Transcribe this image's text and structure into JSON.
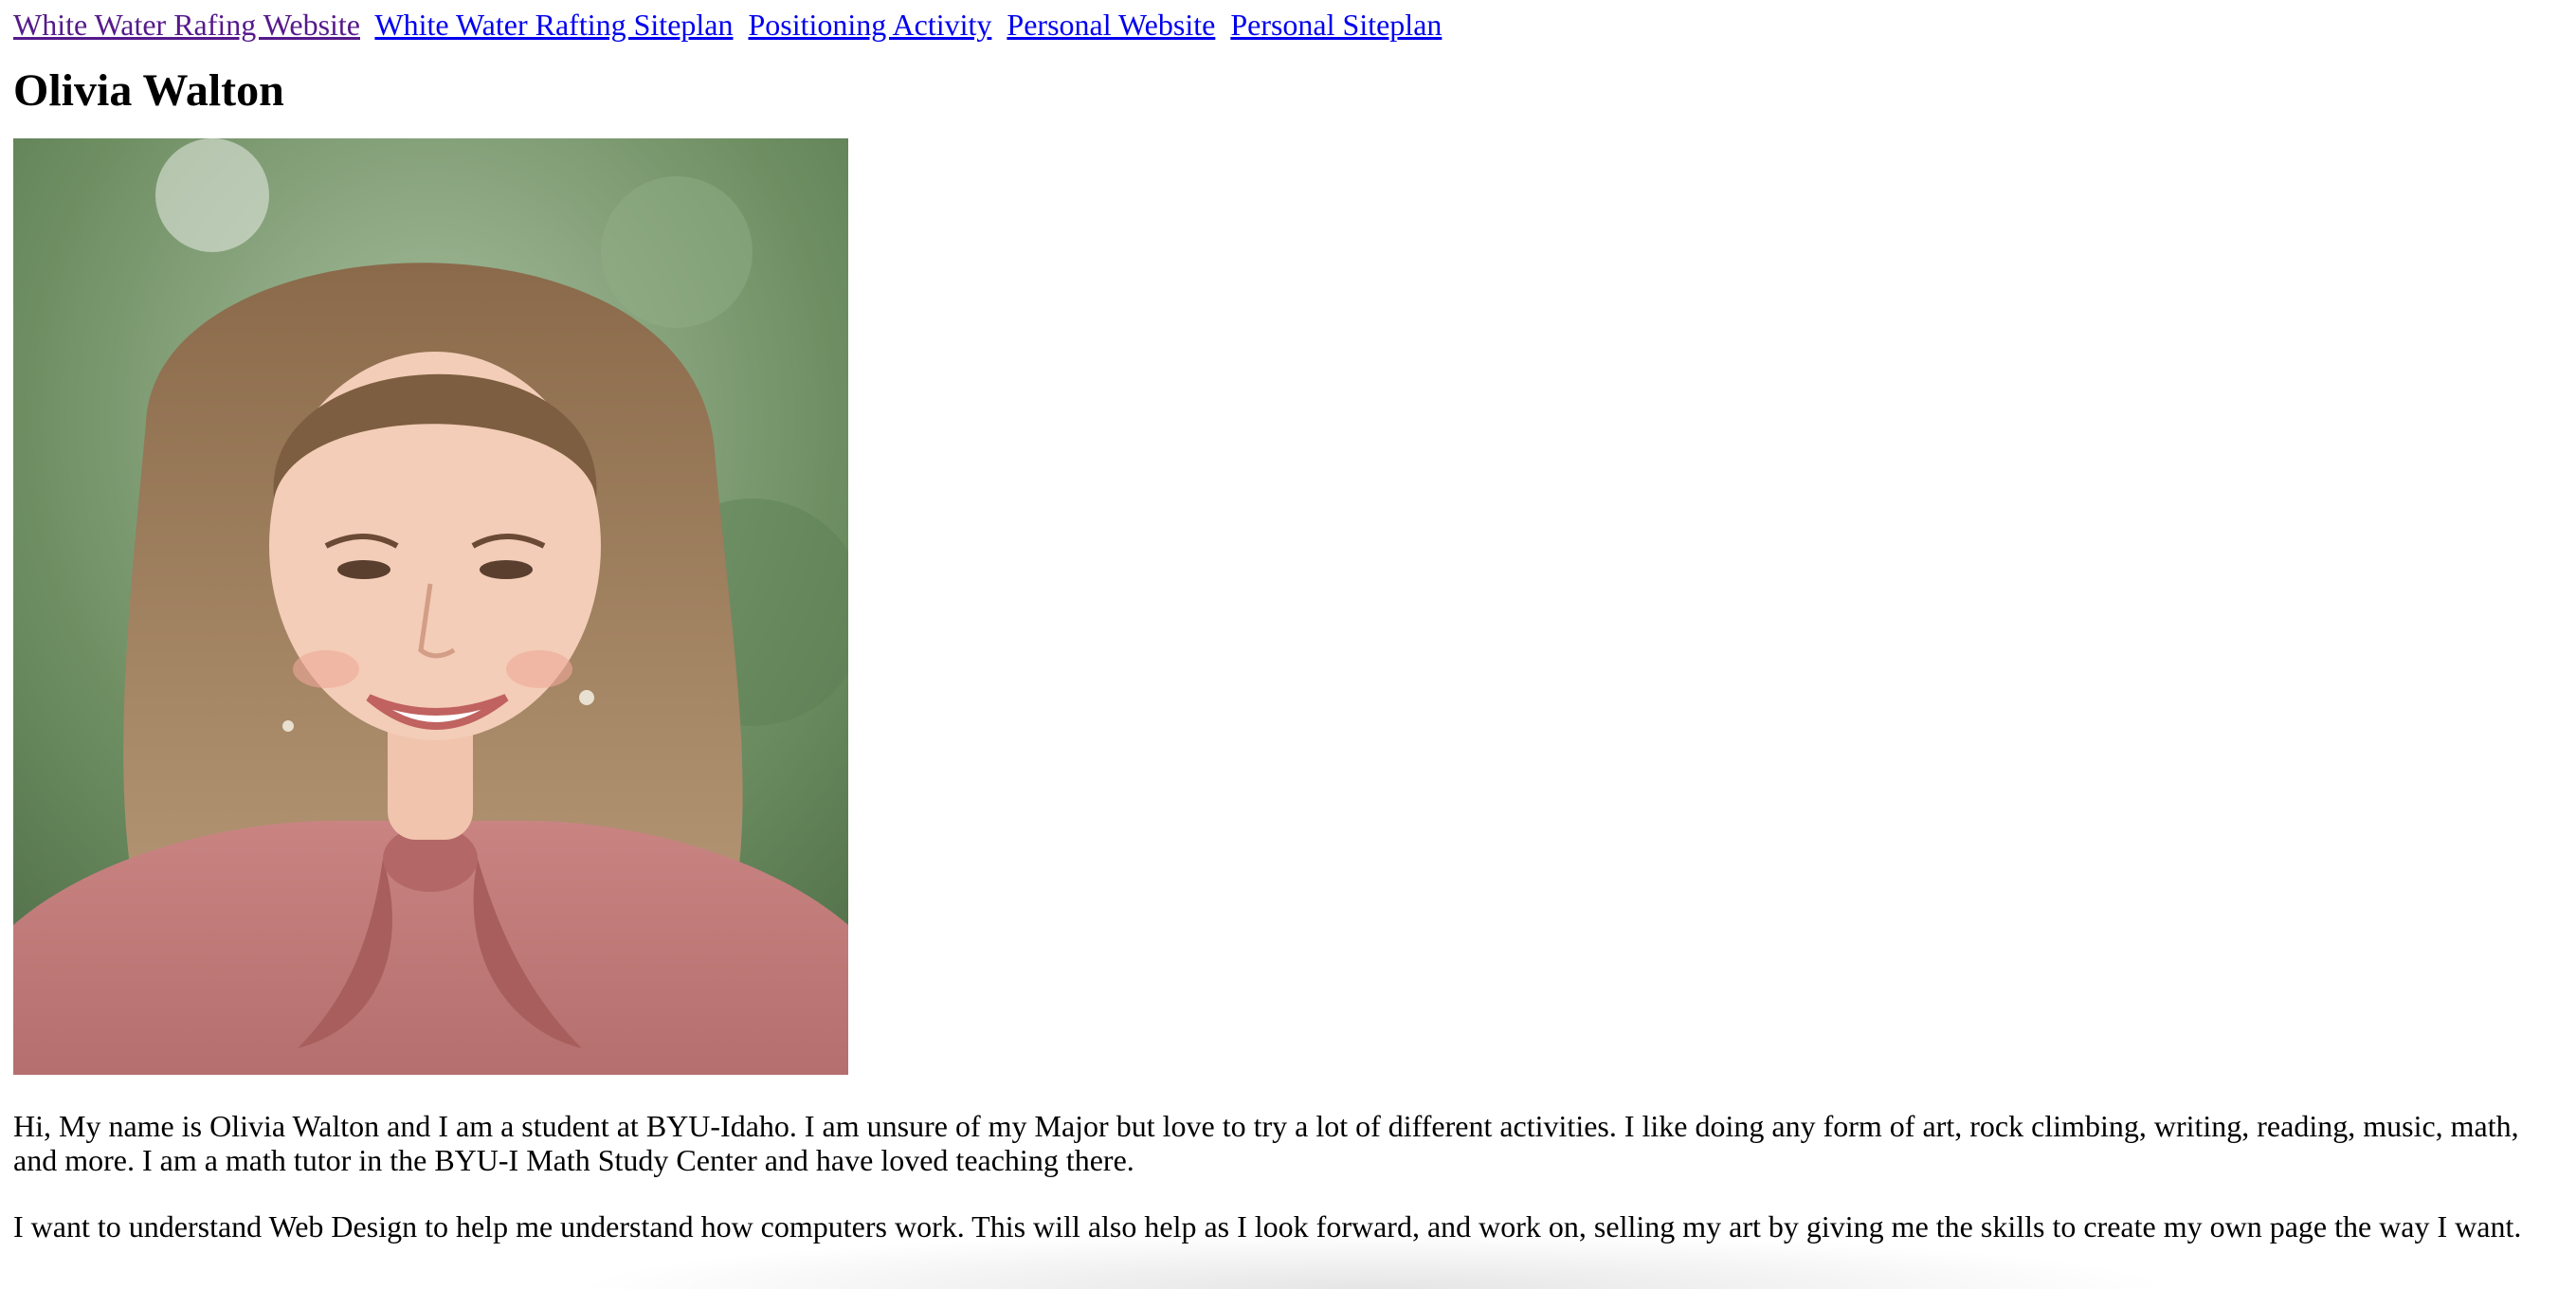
{
  "nav": {
    "links": [
      "White Water Rafing Website",
      "White Water Rafting Siteplan",
      "Positioning Activity",
      "Personal Website",
      "Personal Siteplan"
    ]
  },
  "heading": "Olivia Walton",
  "intro": {
    "p1": "Hi, My name is Olivia Walton and I am a student at BYU-Idaho. I am unsure of my Major but love to try a lot of different activities. I like doing any form of art, rock climbing, writing, reading, music, math, and more. I am a math tutor in the BYU-I Math Study Center and have loved teaching there.",
    "p2": "I want to understand Web Design to help me understand how computers work. This will also help as I look forward, and work on, selling my art by giving me the skills to create my own page the way I want."
  },
  "colors": {
    "link": "#0000ee",
    "link_visited": "#551a8b"
  }
}
